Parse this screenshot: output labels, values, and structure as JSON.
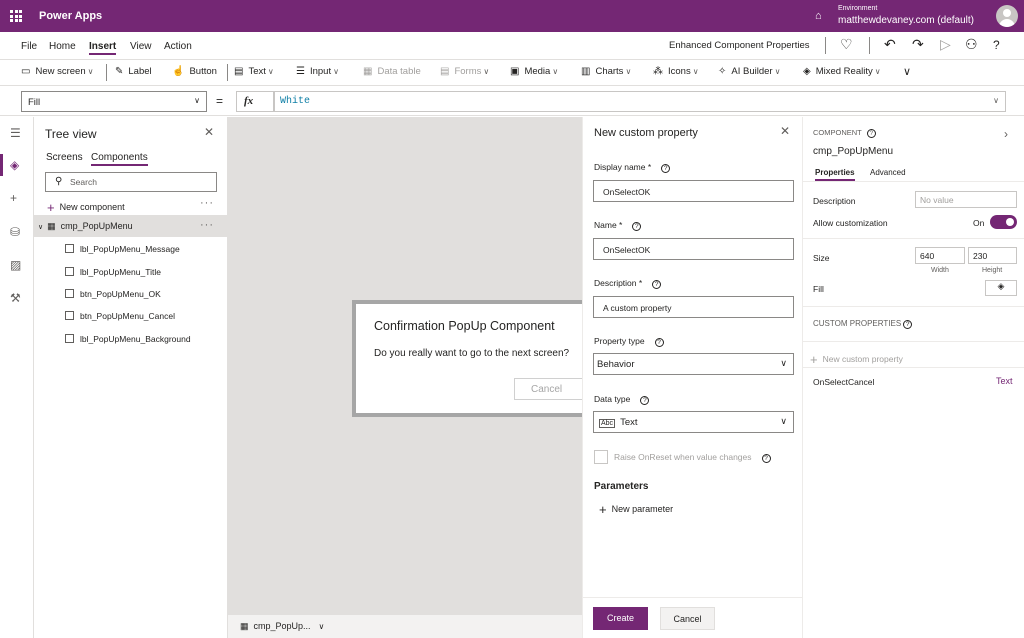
{
  "app": {
    "title": "Power Apps",
    "environment_label": "Environment",
    "environment_name": "matthewdevaney.com (default)"
  },
  "menu": {
    "items": [
      "File",
      "Home",
      "Insert",
      "View",
      "Action"
    ],
    "active": "Insert",
    "project_name": "Enhanced Component Properties"
  },
  "toolbar": {
    "new_screen": "New screen",
    "label": "Label",
    "button": "Button",
    "text": "Text",
    "input": "Input",
    "data_table": "Data table",
    "forms": "Forms",
    "media": "Media",
    "charts": "Charts",
    "icons": "Icons",
    "ai_builder": "AI Builder",
    "mixed_reality": "Mixed Reality"
  },
  "formula_bar": {
    "property": "Fill",
    "fx": "fx",
    "formula": "White"
  },
  "tree_view": {
    "title": "Tree view",
    "tabs": [
      "Screens",
      "Components"
    ],
    "active_tab": "Components",
    "search_placeholder": "Search",
    "new_component": "New component",
    "component": "cmp_PopUpMenu",
    "children": [
      "lbl_PopUpMenu_Message",
      "lbl_PopUpMenu_Title",
      "btn_PopUpMenu_OK",
      "btn_PopUpMenu_Cancel",
      "lbl_PopUpMenu_Background"
    ]
  },
  "canvas": {
    "popup_title": "Confirmation PopUp Component",
    "popup_message": "Do you really want to go to the next screen?",
    "popup_cancel": "Cancel",
    "bottom_component": "cmp_PopUp..."
  },
  "new_property_panel": {
    "title": "New custom property",
    "display_name_label": "Display name *",
    "display_name_value": "OnSelectOK",
    "name_label": "Name *",
    "name_value": "OnSelectOK",
    "description_label": "Description *",
    "description_value": "A custom property",
    "property_type_label": "Property type",
    "property_type_value": "Behavior",
    "data_type_label": "Data type",
    "data_type_value": "Text",
    "raise_onreset": "Raise OnReset when value changes",
    "parameters_header": "Parameters",
    "new_parameter": "New parameter",
    "create": "Create",
    "cancel": "Cancel"
  },
  "right_panel": {
    "component_label": "COMPONENT",
    "component_name": "cmp_PopUpMenu",
    "tabs": [
      "Properties",
      "Advanced"
    ],
    "description_label": "Description",
    "description_placeholder": "No value",
    "allow_customization_label": "Allow customization",
    "allow_customization_value": "On",
    "size_label": "Size",
    "width": "640",
    "height": "230",
    "width_label": "Width",
    "height_label": "Height",
    "fill_label": "Fill",
    "custom_properties_header": "CUSTOM PROPERTIES",
    "new_custom_property": "New custom property",
    "custom_property_name": "OnSelectCancel",
    "custom_property_type": "Text"
  },
  "colors": {
    "brand": "#742774",
    "formula": "#0f7fa6"
  }
}
